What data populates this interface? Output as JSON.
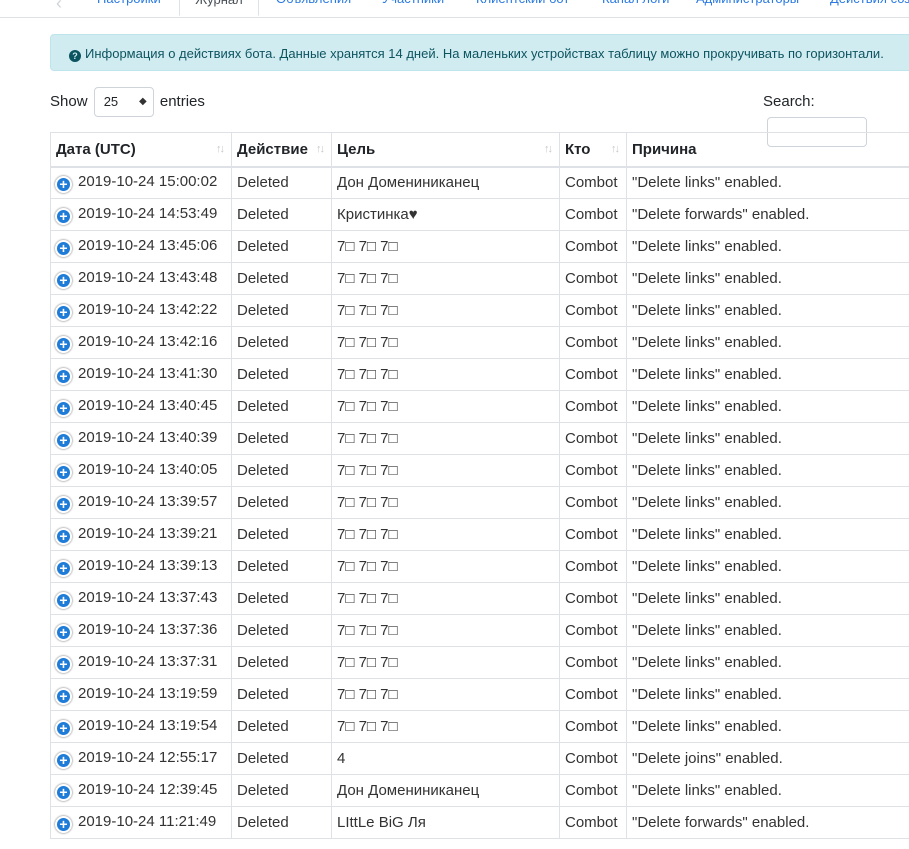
{
  "tabs": [
    {
      "label": "Настройки",
      "active": false
    },
    {
      "label": "Журнал",
      "active": true
    },
    {
      "label": "Объявления",
      "active": false
    },
    {
      "label": "Участники",
      "active": false
    },
    {
      "label": "Клиентский бот",
      "active": false
    },
    {
      "label": "Канал логи",
      "active": false
    },
    {
      "label": "Администраторы",
      "active": false
    },
    {
      "label": "Действия соз",
      "active": false
    }
  ],
  "alert": {
    "text": "Информация о действиях бота. Данные хранятся 14 дней. На маленьких устройствах таблицу можно прокручивать по горизонтали."
  },
  "length": {
    "show_label": "Show",
    "value": "25",
    "entries_label": "entries"
  },
  "search": {
    "label": "Search:",
    "value": ""
  },
  "table": {
    "headers": [
      "Дата (UTC)",
      "Действие",
      "Цель",
      "Кто",
      "Причина"
    ],
    "rows": [
      {
        "date": "2019-10-24 15:00:02",
        "action": "Deleted",
        "target": "Дон Домениниканец",
        "who": "Combot",
        "reason": "\"Delete links\" enabled."
      },
      {
        "date": "2019-10-24 14:53:49",
        "action": "Deleted",
        "target": "Кристинка♥",
        "who": "Combot",
        "reason": "\"Delete forwards\" enabled."
      },
      {
        "date": "2019-10-24 13:45:06",
        "action": "Deleted",
        "target": "7□ 7□ 7□",
        "who": "Combot",
        "reason": "\"Delete links\" enabled."
      },
      {
        "date": "2019-10-24 13:43:48",
        "action": "Deleted",
        "target": "7□ 7□ 7□",
        "who": "Combot",
        "reason": "\"Delete links\" enabled."
      },
      {
        "date": "2019-10-24 13:42:22",
        "action": "Deleted",
        "target": "7□ 7□ 7□",
        "who": "Combot",
        "reason": "\"Delete links\" enabled."
      },
      {
        "date": "2019-10-24 13:42:16",
        "action": "Deleted",
        "target": "7□ 7□ 7□",
        "who": "Combot",
        "reason": "\"Delete links\" enabled."
      },
      {
        "date": "2019-10-24 13:41:30",
        "action": "Deleted",
        "target": "7□ 7□ 7□",
        "who": "Combot",
        "reason": "\"Delete links\" enabled."
      },
      {
        "date": "2019-10-24 13:40:45",
        "action": "Deleted",
        "target": "7□ 7□ 7□",
        "who": "Combot",
        "reason": "\"Delete links\" enabled."
      },
      {
        "date": "2019-10-24 13:40:39",
        "action": "Deleted",
        "target": "7□ 7□ 7□",
        "who": "Combot",
        "reason": "\"Delete links\" enabled."
      },
      {
        "date": "2019-10-24 13:40:05",
        "action": "Deleted",
        "target": "7□ 7□ 7□",
        "who": "Combot",
        "reason": "\"Delete links\" enabled."
      },
      {
        "date": "2019-10-24 13:39:57",
        "action": "Deleted",
        "target": "7□ 7□ 7□",
        "who": "Combot",
        "reason": "\"Delete links\" enabled."
      },
      {
        "date": "2019-10-24 13:39:21",
        "action": "Deleted",
        "target": "7□ 7□ 7□",
        "who": "Combot",
        "reason": "\"Delete links\" enabled."
      },
      {
        "date": "2019-10-24 13:39:13",
        "action": "Deleted",
        "target": "7□ 7□ 7□",
        "who": "Combot",
        "reason": "\"Delete links\" enabled."
      },
      {
        "date": "2019-10-24 13:37:43",
        "action": "Deleted",
        "target": "7□ 7□ 7□",
        "who": "Combot",
        "reason": "\"Delete links\" enabled."
      },
      {
        "date": "2019-10-24 13:37:36",
        "action": "Deleted",
        "target": "7□ 7□ 7□",
        "who": "Combot",
        "reason": "\"Delete links\" enabled."
      },
      {
        "date": "2019-10-24 13:37:31",
        "action": "Deleted",
        "target": "7□ 7□ 7□",
        "who": "Combot",
        "reason": "\"Delete links\" enabled."
      },
      {
        "date": "2019-10-24 13:19:59",
        "action": "Deleted",
        "target": "7□ 7□ 7□",
        "who": "Combot",
        "reason": "\"Delete links\" enabled."
      },
      {
        "date": "2019-10-24 13:19:54",
        "action": "Deleted",
        "target": "7□ 7□ 7□",
        "who": "Combot",
        "reason": "\"Delete links\" enabled."
      },
      {
        "date": "2019-10-24 12:55:17",
        "action": "Deleted",
        "target": "4",
        "who": "Combot",
        "reason": "\"Delete joins\" enabled."
      },
      {
        "date": "2019-10-24 12:39:45",
        "action": "Deleted",
        "target": "Дон Домениниканец",
        "who": "Combot",
        "reason": "\"Delete links\" enabled."
      },
      {
        "date": "2019-10-24 11:21:49",
        "action": "Deleted",
        "target": "LIttLe BiG Ля",
        "who": "Combot",
        "reason": "\"Delete forwards\" enabled."
      }
    ]
  },
  "colors": {
    "link": "#2a7ae2",
    "alert_bg": "#d1ecf1",
    "expand_icon": "#1e7bd8"
  }
}
